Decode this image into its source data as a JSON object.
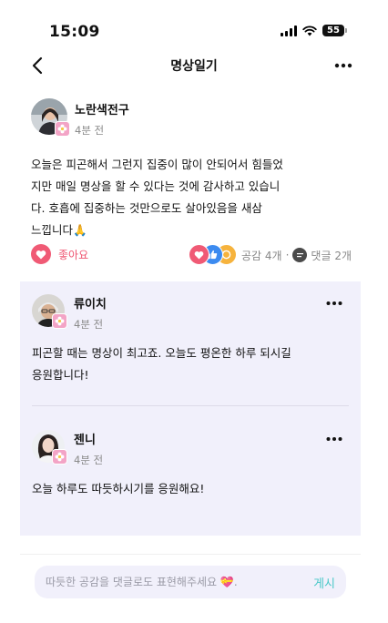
{
  "status_bar": {
    "time": "15:09",
    "battery": "55"
  },
  "header": {
    "title": "명상일기"
  },
  "post": {
    "author_name": "노란색전구",
    "time_ago": "4분 전",
    "body_lines": [
      "오늘은 피곤해서 그런지 집중이 많이 안되어서 힘들었",
      "지만 매일 명상을 할 수 있다는 것에 감사하고 있습니",
      "다. 호흡에 집중하는 것만으로도 살아있음을 새삼",
      "느낍니다🙏"
    ],
    "like_label": "좋아요",
    "empathy_text": "공감 4개",
    "separator": "·",
    "comment_count_text": "댓글 2개"
  },
  "comments": [
    {
      "author_name": "류이치",
      "time_ago": "4분 전",
      "text_lines": [
        "피곤할 때는 명상이 최고죠. 오늘도 평온한 하루 되시길",
        "응원합니다!"
      ]
    },
    {
      "author_name": "젠니",
      "time_ago": "4분 전",
      "text_lines": [
        "오늘 하루도 따듯하시기를 응원해요!"
      ]
    }
  ],
  "comment_input": {
    "placeholder": "따듯한 공감을 댓글로도 표현해주세요 💝.",
    "submit_label": "게시"
  },
  "colors": {
    "like": "#f05a75",
    "comments_bg": "#f1f0fb",
    "submit": "#49c8c8"
  }
}
